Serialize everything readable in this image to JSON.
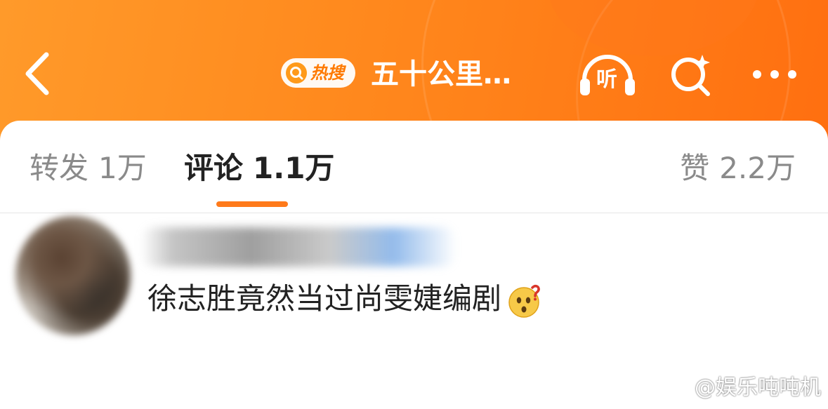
{
  "header": {
    "hot_badge_label": "热搜",
    "topic_title": "五十公里…",
    "listen_label": "听"
  },
  "tabs": {
    "repost": {
      "label": "转发",
      "count": "1万"
    },
    "comment": {
      "label": "评论",
      "count": "1.1万"
    },
    "like": {
      "label": "赞",
      "count": "2.2万"
    }
  },
  "comment": {
    "text": "徐志胜竟然当过尚雯婕编剧",
    "emoji": "thinking-face-emoji"
  },
  "watermark": {
    "text": "@娱乐吨吨机"
  },
  "colors": {
    "header_orange": "#ff8a1e",
    "accent": "#ff7a1a"
  },
  "icons": [
    "back-arrow-icon",
    "search-icon",
    "headphones-icon",
    "search-sparkle-icon",
    "more-icon",
    "thinking-face-emoji",
    "weibo-logo-icon"
  ]
}
